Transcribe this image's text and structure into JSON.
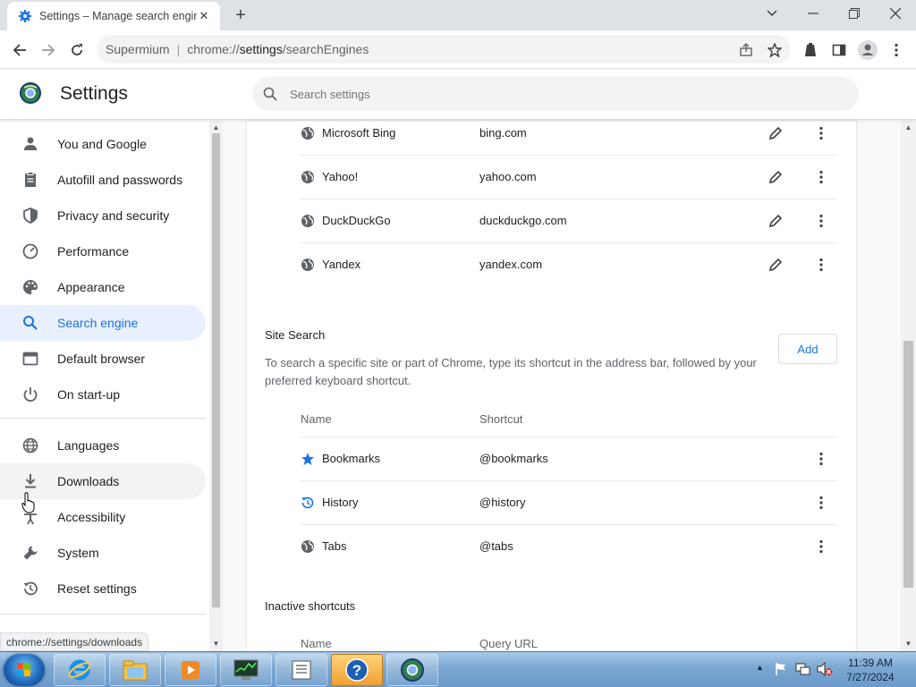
{
  "browser": {
    "tab_title": "Settings – Manage search engines",
    "origin": "Supermium",
    "url_prefix": "chrome://",
    "url_host": "settings",
    "url_path": "/searchEngines"
  },
  "settings": {
    "title": "Settings",
    "search_placeholder": "Search settings"
  },
  "sidebar": {
    "items": [
      {
        "label": "You and Google",
        "icon": "person-icon"
      },
      {
        "label": "Autofill and passwords",
        "icon": "clipboard-icon"
      },
      {
        "label": "Privacy and security",
        "icon": "shield-icon"
      },
      {
        "label": "Performance",
        "icon": "speedometer-icon"
      },
      {
        "label": "Appearance",
        "icon": "palette-icon"
      },
      {
        "label": "Search engine",
        "icon": "search-icon"
      },
      {
        "label": "Default browser",
        "icon": "browser-window-icon"
      },
      {
        "label": "On start-up",
        "icon": "power-icon"
      },
      {
        "label": "Languages",
        "icon": "globe-icon"
      },
      {
        "label": "Downloads",
        "icon": "download-icon"
      },
      {
        "label": "Accessibility",
        "icon": "accessibility-icon"
      },
      {
        "label": "System",
        "icon": "wrench-icon"
      },
      {
        "label": "Reset settings",
        "icon": "reset-icon"
      }
    ],
    "active_index": 5
  },
  "search_engines": [
    {
      "name": "Microsoft Bing",
      "shortcut": "bing.com"
    },
    {
      "name": "Yahoo!",
      "shortcut": "yahoo.com"
    },
    {
      "name": "DuckDuckGo",
      "shortcut": "duckduckgo.com"
    },
    {
      "name": "Yandex",
      "shortcut": "yandex.com"
    }
  ],
  "site_search": {
    "title": "Site Search",
    "description": "To search a specific site or part of Chrome, type its shortcut in the address bar, followed by your preferred keyboard shortcut.",
    "add_label": "Add",
    "col_name": "Name",
    "col_shortcut": "Shortcut",
    "rows": [
      {
        "name": "Bookmarks",
        "shortcut": "@bookmarks",
        "icon": "star-icon"
      },
      {
        "name": "History",
        "shortcut": "@history",
        "icon": "history-icon"
      },
      {
        "name": "Tabs",
        "shortcut": "@tabs",
        "icon": "globe-icon"
      }
    ]
  },
  "inactive": {
    "title": "Inactive shortcuts",
    "col_name": "Name",
    "col_query": "Query URL"
  },
  "status_url": "chrome://settings/downloads",
  "clock": {
    "time": "11:39 AM",
    "date": "7/27/2024"
  },
  "colors": {
    "accent": "#1a73e8",
    "active_bg": "#e8f0fe"
  }
}
